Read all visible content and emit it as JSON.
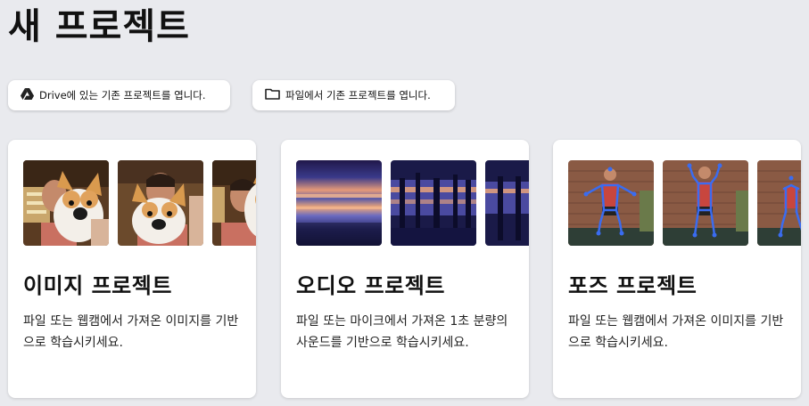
{
  "page": {
    "title": "새 프로젝트"
  },
  "buttons": {
    "drive": {
      "label": "Drive에 있는 기존 프로젝트를 엽니다.",
      "icon": "google-drive-icon"
    },
    "file": {
      "label": "파일에서 기존 프로젝트를 엽니다.",
      "icon": "folder-icon"
    }
  },
  "cards": [
    {
      "title": "이미지 프로젝트",
      "description": "파일 또는 웹캠에서 가져온 이미지를 기반으로 학습시키세요."
    },
    {
      "title": "오디오 프로젝트",
      "description": "파일 또는 마이크에서 가져온 1초 분량의 사운드를 기반으로 학습시키세요."
    },
    {
      "title": "포즈 프로젝트",
      "description": "파일 또는 웹캠에서 가져온 이미지를 기반으로 학습시키세요."
    }
  ],
  "colors": {
    "background": "#e9eaee",
    "card": "#ffffff",
    "spectrogram_low": "#1a1f5c",
    "spectrogram_high": "#f0a070",
    "pose_skeleton": "#3a6cf0"
  }
}
